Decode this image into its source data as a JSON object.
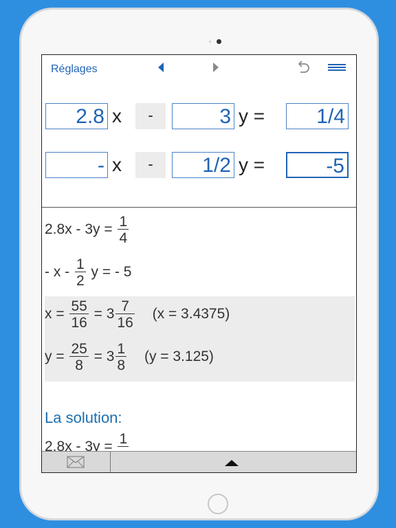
{
  "toolbar": {
    "settings_label": "Réglages",
    "prev_icon": "triangle-left-icon",
    "next_icon": "triangle-right-icon",
    "undo_icon": "undo-icon",
    "menu_icon": "menu-icon"
  },
  "equations": [
    {
      "a": "2.8",
      "x_label": "x",
      "op": "-",
      "b": "3",
      "y_label": "y =",
      "c": "1/4"
    },
    {
      "a": "-",
      "x_label": "x",
      "op": "-",
      "b": "1/2",
      "y_label": "y =",
      "c": "-5"
    }
  ],
  "result": {
    "eq1": {
      "lhs": "2.8x - 3y = ",
      "num": "1",
      "den": "4"
    },
    "eq2": {
      "lhs": "- x - ",
      "num": "1",
      "den": "2",
      "rhs": " y = - 5"
    },
    "x": {
      "prefix": "x = ",
      "num": "55",
      "den": "16",
      "mid": " = 3",
      "mixed_num": "7",
      "mixed_den": "16",
      "decimal": "(x = 3.4375)"
    },
    "y": {
      "prefix": "y = ",
      "num": "25",
      "den": "8",
      "mid": " = 3",
      "mixed_num": "1",
      "mixed_den": "8",
      "decimal": "(y = 3.125)"
    }
  },
  "solution": {
    "title": "La solution:",
    "first_line": "2.8x - 3y = ",
    "num": "1"
  },
  "bottombar": {
    "mail_icon": "envelope-icon",
    "expand_icon": "triangle-up-icon"
  },
  "colors": {
    "accent": "#1f63b5",
    "background": "#2e8fe0",
    "solution_title": "#1c6fb0"
  }
}
